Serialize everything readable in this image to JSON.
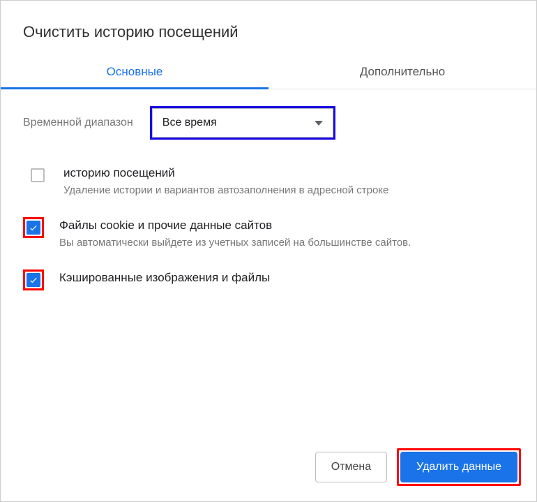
{
  "dialog": {
    "title": "Очистить историю посещений"
  },
  "tabs": {
    "basic": "Основные",
    "advanced": "Дополнительно"
  },
  "time_range": {
    "label": "Временной диапазон",
    "selected": "Все время"
  },
  "options": [
    {
      "checked": false,
      "highlighted": false,
      "title": "историю посещений",
      "description": "Удаление истории и вариантов автозаполнения в адресной строке"
    },
    {
      "checked": true,
      "highlighted": true,
      "title": "Файлы cookie и прочие данные сайтов",
      "description": "Вы автоматически выйдете из учетных записей на большинстве сайтов."
    },
    {
      "checked": true,
      "highlighted": true,
      "title": "Кэшированные изображения и файлы",
      "description": ""
    }
  ],
  "buttons": {
    "cancel": "Отмена",
    "clear": "Удалить данные"
  }
}
